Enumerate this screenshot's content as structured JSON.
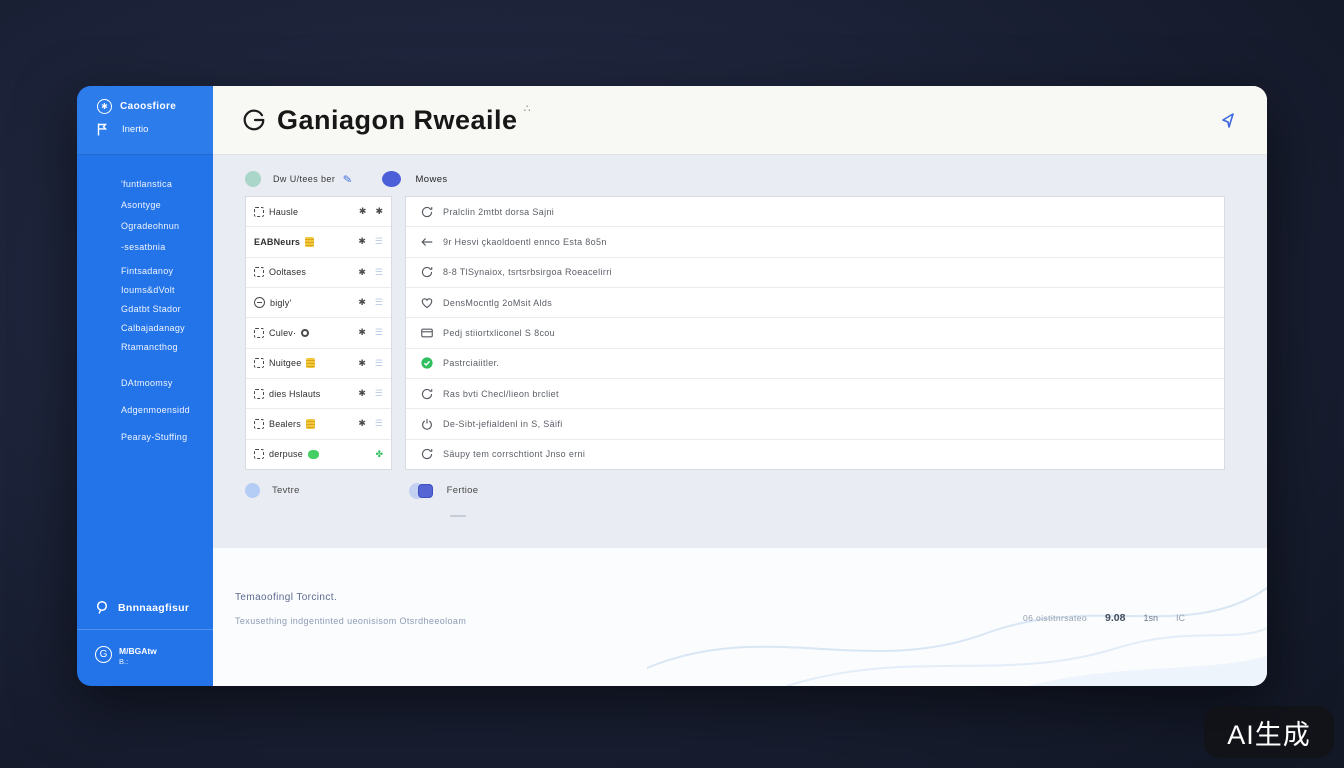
{
  "sidebar": {
    "brand": {
      "title": "Caoosfiore",
      "subtitle": "Inertio"
    },
    "groups": [
      [
        "'funtlanstica"
      ],
      [
        "Asontyge",
        "Ogradeohnun",
        "-sesatbnia"
      ],
      [
        "Fintsadanoy",
        "Ioums&dVolt",
        "Gdatbt Stador",
        "Calbajadanagy",
        "Rtamancthog"
      ],
      [
        "DAtmoomsy",
        "Adgenmoensidd",
        "Pearay-Stuffing"
      ]
    ],
    "footer_primary": "Bnnnaagfisur",
    "footer_secondary_line1": "M/BGAtw",
    "footer_secondary_line2": "B.:"
  },
  "header": {
    "title": "Ganiagon Rweaile",
    "title_mark": "∴",
    "logo_icon": "g-circle-icon",
    "action_icon": "send-arrow-icon"
  },
  "sections": {
    "left_label": "Dw U/tees ber",
    "left_badge_color": "#a9d6c8",
    "edit_icon": "✎",
    "right_label": "Mowes",
    "right_badge_color": "#4d5fd8"
  },
  "left_list": [
    {
      "icon": "square",
      "label": "Hausle",
      "badge": "none",
      "glyph1": "asterisk",
      "glyph2": "asterisk-dark"
    },
    {
      "icon": "none",
      "label": "EABNeurs",
      "badge": "yellow",
      "glyph1": "asterisk",
      "glyph2": "lines",
      "bold": true
    },
    {
      "icon": "square",
      "label": "Ooltases",
      "badge": "none",
      "glyph1": "asterisk",
      "glyph2": "lines"
    },
    {
      "icon": "circle",
      "label": "bigly'",
      "badge": "none",
      "glyph1": "asterisk",
      "glyph2": "lines"
    },
    {
      "icon": "square",
      "label": "Culev·",
      "badge": "dark",
      "glyph1": "asterisk",
      "glyph2": "lines"
    },
    {
      "icon": "square",
      "label": "Nuitgee",
      "badge": "yellow",
      "glyph1": "asterisk",
      "glyph2": "lines"
    },
    {
      "icon": "square",
      "label": "dies Hslauts",
      "badge": "none",
      "glyph1": "asterisk",
      "glyph2": "lines"
    },
    {
      "icon": "square",
      "label": "Bealers",
      "badge": "yellow",
      "glyph1": "asterisk",
      "glyph2": "lines"
    },
    {
      "icon": "square",
      "label": "derpuse",
      "badge": "green",
      "glyph1": "flower-green",
      "glyph2": "none"
    }
  ],
  "right_list": [
    {
      "icon": "refresh",
      "text": "Pralclin 2mtbt dorsa Sajni"
    },
    {
      "icon": "arrow-left",
      "text": "9r Hesvi çkaoldoentl ennco Esta 8o5n"
    },
    {
      "icon": "refresh",
      "text": "8-8 TlSynaiox, tsrtsrbsirgoa Roeacelirri"
    },
    {
      "icon": "heart",
      "text": "DensMocntlg 2oMsit Alds"
    },
    {
      "icon": "card",
      "text": "Pedj stiiortxliconel S 8cou"
    },
    {
      "icon": "check-circle",
      "text": "Pastrciaiitler."
    },
    {
      "icon": "refresh",
      "text": "Ras bvti Checl/lieon brcliet"
    },
    {
      "icon": "power",
      "text": "De-Sibt-jefialdenl in S, Säifi"
    },
    {
      "icon": "refresh",
      "text": "Säupy tem corrschtiont Jnso erni"
    }
  ],
  "legend": {
    "item1": "Tevtre",
    "item1_color": "#b3cdf4",
    "item2": "Fertioe",
    "item2_color": "#5565d4"
  },
  "footer": {
    "line1": "Temaoofingl Torcinct.",
    "line2": "Texusething indgentinted ueonisisom Otsrdheeoloam",
    "stats": {
      "label": "06 oistitnrsateo",
      "value": "9.08",
      "unit": "1sn",
      "code": "IC"
    }
  },
  "watermark": "AI生成"
}
